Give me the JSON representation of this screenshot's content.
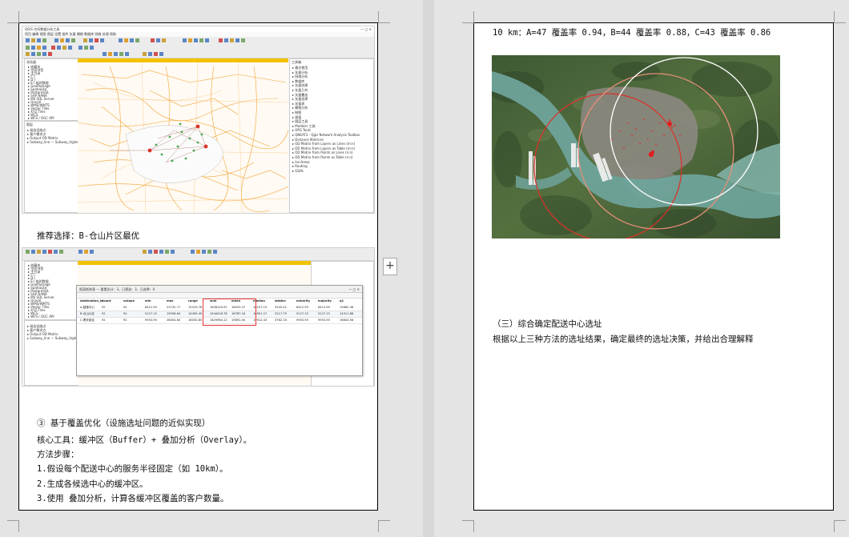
{
  "left_page": {
    "screenshot1": {
      "title_bar": "QGIS 空间数据分析工具",
      "menu": "项目 编辑 视图 图层 设置 插件 矢量 栅格 数据库 网络 处理 帮助",
      "layers_panel_title": "浏览器",
      "layers_panel2_title": "图层",
      "processing_title": "工具箱",
      "layer_items": [
        "收藏夹",
        "空间书签",
        "主目录",
        "C:\\",
        "D:\\",
        "E:\\ 临时数据",
        "GeoPackage",
        "SpatiaLite",
        "PostgreSQL",
        "SAP HANA",
        "MS SQL Server",
        "Oracle",
        "WMS/WMTS",
        "Vector Tiles",
        "XYZ Tiles",
        "WCS",
        "WFS / OGC API"
      ],
      "layer_list": [
        "候选设施点",
        "客户需求点",
        "Output OD Matrix",
        "Subway_line — Subway_highway Sub"
      ],
      "toolbox_items": [
        "最近使用",
        "矢量分析",
        "网络分析",
        "数据库",
        "矢量创建",
        "矢量几何",
        "矢量叠加",
        "矢量选择",
        "矢量表",
        "栅格分析",
        "制图",
        "插值",
        "图层工具",
        "Modeler 工具",
        "ORS Tools",
        "QNEAT3 - Qgis Network Analysis Toolbox",
        "Distance Matrices",
        "OD Matrix from Layers as Lines (m:n)",
        "OD Matrix from Layers as Table (m:n)",
        "OD Matrix from Points as Lines (n:n)",
        "OD Matrix from Points as Table (n:n)",
        "Iso-Areas",
        "Routing",
        "GDAL"
      ]
    },
    "caption1": "推荐选择：B-仓山片区最优",
    "screenshot2": {
      "table_title": "距离矩阵表 — 要素总计：3，已筛选：3，已选择：0",
      "table_headers": [
        "destination_id",
        "count",
        "unique",
        "min",
        "max",
        "range",
        "sum",
        "mean",
        "median",
        "stddev",
        "minority",
        "majority",
        "q1"
      ],
      "table_rows": [
        [
          "A-鼓楼中心",
          "92",
          "92",
          "8412.99",
          "23732.77",
          "15319.78",
          "1658149.92",
          "18023.37",
          "18107.19",
          "3345.42",
          "8412.99",
          "8412.99",
          "15662.38"
        ],
        [
          "B-仓山片区",
          "92",
          "92",
          "5127.15",
          "19536.64",
          "14409.49",
          "1544418.78",
          "16787.16",
          "16901.27",
          "3117.79",
          "5127.15",
          "5127.15",
          "14311.88"
        ],
        [
          "C-晋安新区",
          "92",
          "92",
          "9953.95",
          "28004.80",
          "18050.85",
          "1829964.12",
          "19891.00",
          "19912.43",
          "3762.16",
          "9953.95",
          "9953.95",
          "16843.58"
        ]
      ]
    },
    "paragraphs": [
      "③ 基于覆盖优化（设施选址问题的近似实现）",
      "核心工具：缓冲区（Buffer）+ 叠加分析（Overlay）。",
      "方法步骤：",
      "1.假设每个配送中心的服务半径固定（如 10km）。",
      "2.生成各候选中心的缓冲区。",
      "3.使用 叠加分析，计算各缓冲区覆盖的客户数量。"
    ]
  },
  "right_page": {
    "top_line": "10 km：A=47 覆盖率 0.94，B=44 覆盖率 0.88，C=43 覆盖率 0.86",
    "heading": "（三）综合确定配送中心选址",
    "body": "根据以上三种方法的选址结果，确定最终的选址决策，并给出合理解释"
  },
  "colors": {
    "page_bg": "#ffffff",
    "canvas_bg": "#e4e4e4",
    "map_road": "#f29a1e",
    "buffer_red": "#d9342b",
    "buffer_salmon": "#e8907a",
    "buffer_white": "#ffffff",
    "highlight_box": "#e53935"
  }
}
